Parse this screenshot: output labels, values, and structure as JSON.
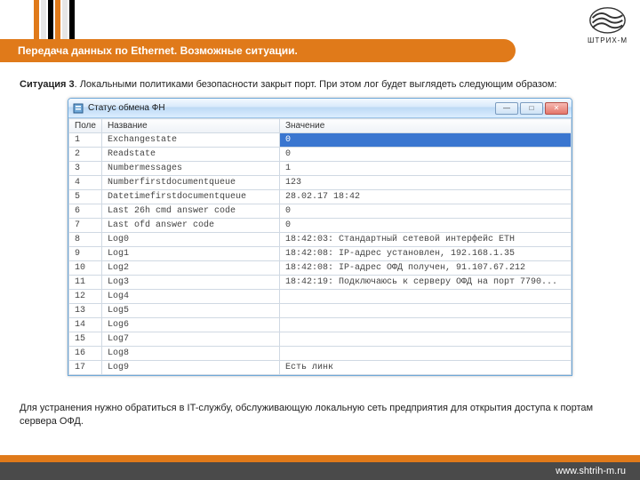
{
  "brand": {
    "name": "ШТРИХ-М"
  },
  "page_title": "Передача данных по Ethernet. Возможные ситуации.",
  "situation": {
    "label": "Ситуация 3",
    "desc": ". Локальными политиками безопасности закрыт порт. При этом лог будет выглядеть следующим образом:"
  },
  "window": {
    "title": "Статус обмена ФН",
    "columns": {
      "c0": "Поле",
      "c1": "Название",
      "c2": "Значение"
    },
    "rows": [
      {
        "idx": "1",
        "name": "Exchangestate",
        "value": "0"
      },
      {
        "idx": "2",
        "name": "Readstate",
        "value": "0"
      },
      {
        "idx": "3",
        "name": "Numbermessages",
        "value": "1"
      },
      {
        "idx": "4",
        "name": "Numberfirstdocumentqueue",
        "value": "123"
      },
      {
        "idx": "5",
        "name": "Datetimefirstdocumentqueue",
        "value": "28.02.17 18:42"
      },
      {
        "idx": "6",
        "name": "Last 26h cmd answer code",
        "value": "0"
      },
      {
        "idx": "7",
        "name": "Last ofd answer code",
        "value": "0"
      },
      {
        "idx": "8",
        "name": "Log0",
        "value": "18:42:03: Стандартный сетевой интерфейс ETH"
      },
      {
        "idx": "9",
        "name": "Log1",
        "value": "18:42:08: IP-адрес установлен, 192.168.1.35"
      },
      {
        "idx": "10",
        "name": "Log2",
        "value": "18:42:08: IP-адрес ОФД получен, 91.107.67.212"
      },
      {
        "idx": "11",
        "name": "Log3",
        "value": "18:42:19: Подключаюсь к серверу ОФД на порт 7790..."
      },
      {
        "idx": "12",
        "name": "Log4",
        "value": ""
      },
      {
        "idx": "13",
        "name": "Log5",
        "value": ""
      },
      {
        "idx": "14",
        "name": "Log6",
        "value": ""
      },
      {
        "idx": "15",
        "name": "Log7",
        "value": ""
      },
      {
        "idx": "16",
        "name": "Log8",
        "value": ""
      },
      {
        "idx": "17",
        "name": "Log9",
        "value": "Есть линк"
      }
    ],
    "buttons": {
      "min": "—",
      "max": "□",
      "close": "✕"
    }
  },
  "footnote": "Для устранения нужно обратиться в IT-службу, обслуживающую локальную сеть предприятия для открытия доступа к портам сервера ОФД.",
  "footer": {
    "url": "www.shtrih-m.ru"
  }
}
